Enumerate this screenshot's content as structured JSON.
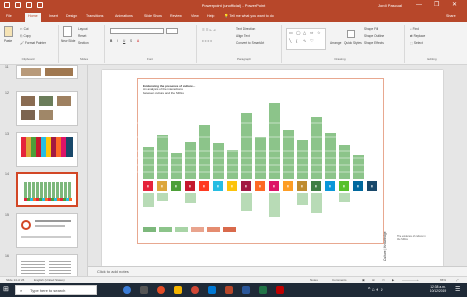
{
  "window": {
    "title": "Powerpoint (unofficial) - PowerPoint",
    "user": "Jordi Pascual",
    "minimize": "—",
    "restore": "❐",
    "close": "✕",
    "tell_me": "Tell me what you want to do",
    "share": "Share"
  },
  "tabs": [
    "File",
    "Home",
    "Insert",
    "Design",
    "Transitions",
    "Animations",
    "Slide Show",
    "Review",
    "View",
    "Help"
  ],
  "ribbon": {
    "clipboard": {
      "paste": "Paste",
      "cut": "Cut",
      "copy": "Copy",
      "format_painter": "Format Painter",
      "label": "Clipboard"
    },
    "slides": {
      "new_slide": "New Slide",
      "layout": "Layout",
      "reset": "Reset",
      "section": "Section",
      "label": "Slides"
    },
    "font": {
      "label": "Font"
    },
    "paragraph": {
      "text_direction": "Text Direction",
      "align_text": "Align Text",
      "smartart": "Convert to SmartArt",
      "label": "Paragraph"
    },
    "drawing": {
      "arrange": "Arrange",
      "quick_styles": "Quick Styles",
      "shape_fill": "Shape Fill",
      "shape_outline": "Shape Outline",
      "shape_effects": "Shape Effects",
      "label": "Drawing"
    },
    "editing": {
      "find": "Find",
      "replace": "Replace",
      "select": "Select",
      "label": "Editing"
    }
  },
  "thumbnails": {
    "numbers": [
      "11",
      "12",
      "13",
      "14",
      "15",
      "16"
    ],
    "selected": "14"
  },
  "slide": {
    "title_line1": "Evidencing the presence of culture...",
    "title_line2": "An analysis of the interactions",
    "title_line3": "between culture and the SDGs",
    "vertical_title": "Culture | Knowledge",
    "side_note": "The evidence of culture in the SDGs"
  },
  "notes_placeholder": "Click to add notes",
  "status": {
    "slide_info": "Slide 14 of 26",
    "language": "English (United States)",
    "notes": "Notes",
    "comments": "Comments",
    "zoom": "65%"
  },
  "taskbar": {
    "search_placeholder": "Type here to search",
    "time": "12:38 a.m.",
    "date": "10/12/2019"
  },
  "colors": {
    "brand": "#b7472a",
    "selected_border": "#d24726",
    "bar_green": "#7db87c",
    "taskbar": "#1f2a37"
  }
}
